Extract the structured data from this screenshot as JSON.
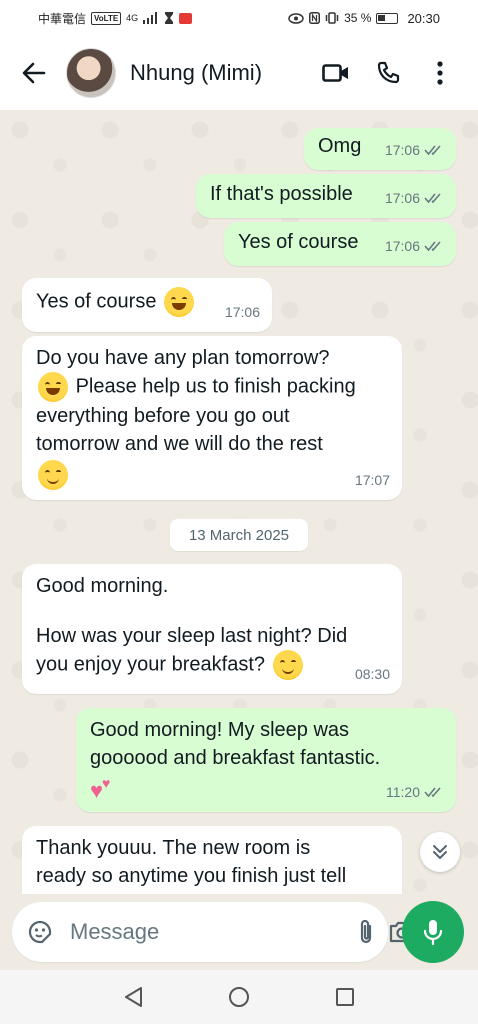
{
  "status_bar": {
    "carrier": "中華電信",
    "volte": "VoLTE",
    "network": "4G",
    "battery_percent": "35 %",
    "time": "20:30"
  },
  "header": {
    "contact_name": "Nhung (Mimi)"
  },
  "messages": [
    {
      "direction": "out",
      "text": "Omg",
      "time": "17:06",
      "status": "read"
    },
    {
      "direction": "out",
      "text": "If that's possible",
      "time": "17:06",
      "status": "read"
    },
    {
      "direction": "out",
      "text": "Yes of course",
      "time": "17:06",
      "status": "read"
    },
    {
      "direction": "in",
      "text": "Yes of course",
      "emoji": "grinning-squinting-face",
      "time": "17:06"
    },
    {
      "direction": "in",
      "line1": "Do you have any plan tomorrow?",
      "line2": "Please help us to finish packing",
      "line3": "everything before you go out",
      "line4": "tomorrow and we will do the rest",
      "emoji1": "grinning-squinting-face",
      "emoji2": "smiling-face",
      "time": "17:07"
    },
    {
      "direction": "in",
      "line1": "Good morning.",
      "line2": "How was your sleep last night? Did",
      "line3": "you enjoy your breakfast?",
      "emoji": "smiling-face",
      "time": "08:30"
    },
    {
      "direction": "out",
      "line1": "Good morning! My sleep was",
      "line2": "goooood and breakfast fantastic.",
      "emoji": "two-hearts",
      "time": "11:20",
      "status": "read"
    },
    {
      "direction": "in",
      "line1": "Thank youuu. The new room is",
      "line2": "ready so anytime you finish just tell"
    }
  ],
  "date_separator": "13 March 2025",
  "input": {
    "placeholder": "Message"
  },
  "colors": {
    "outgoing_bubble": "#d9fdd3",
    "incoming_bubble": "#ffffff",
    "chat_background": "#efeae2",
    "mic_button": "#1daa61",
    "read_ticks": "#667781"
  }
}
